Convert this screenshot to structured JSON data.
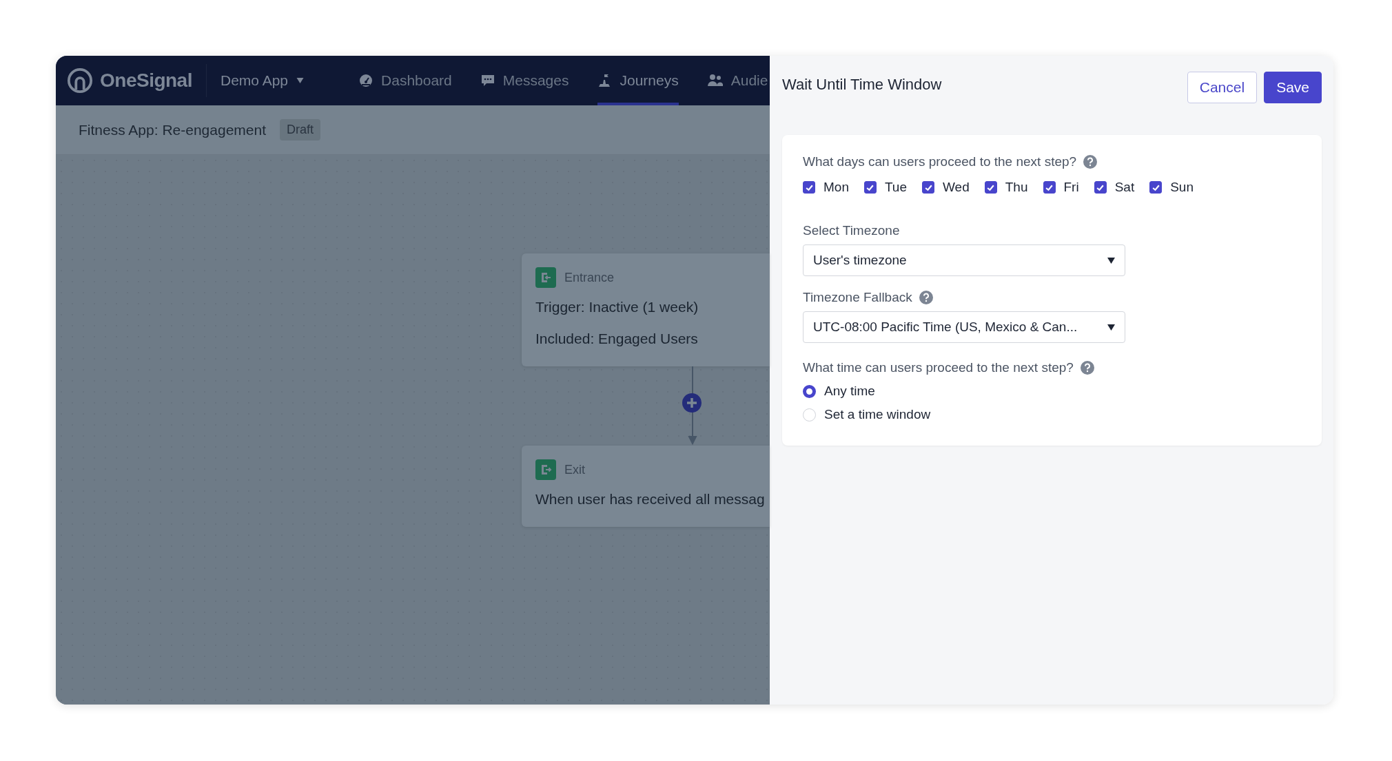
{
  "app": {
    "logo": "OneSignal",
    "app_switcher": "Demo App",
    "nav": [
      {
        "label": "Dashboard",
        "selected": false
      },
      {
        "label": "Messages",
        "selected": false
      },
      {
        "label": "Journeys",
        "selected": true
      },
      {
        "label": "Audie",
        "selected": false
      }
    ],
    "journey_title": "Fitness App: Re-engagement",
    "status_badge": "Draft"
  },
  "canvas": {
    "nodes": [
      {
        "kind": "entrance",
        "title": "Entrance",
        "lines": [
          "Trigger: Inactive (1 week)",
          "Included: Engaged Users"
        ]
      },
      {
        "kind": "exit",
        "title": "Exit",
        "lines": [
          "When user has received all messag"
        ]
      }
    ]
  },
  "panel": {
    "title": "Wait Until Time Window",
    "buttons": [
      {
        "label": "Cancel",
        "kind": "secondary"
      },
      {
        "label": "Save",
        "kind": "primary"
      }
    ],
    "days_question": "What days can users proceed to the next step?",
    "days": [
      {
        "label": "Mon",
        "checked": true
      },
      {
        "label": "Tue",
        "checked": true
      },
      {
        "label": "Wed",
        "checked": true
      },
      {
        "label": "Thu",
        "checked": true
      },
      {
        "label": "Fri",
        "checked": true
      },
      {
        "label": "Sat",
        "checked": true
      },
      {
        "label": "Sun",
        "checked": true
      }
    ],
    "timezone": {
      "label": "Select Timezone",
      "value": "User's timezone"
    },
    "fallback": {
      "label": "Timezone Fallback",
      "value": "UTC-08:00 Pacific Time (US, Mexico & Can..."
    },
    "time_question": "What time can users proceed to the next step?",
    "time_options": [
      {
        "label": "Any time",
        "selected": true
      },
      {
        "label": "Set a time window",
        "selected": false
      }
    ]
  }
}
